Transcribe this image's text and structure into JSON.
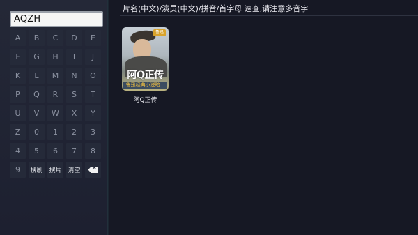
{
  "search": {
    "query": "AQZH"
  },
  "keyboard": {
    "keys": [
      "A",
      "B",
      "C",
      "D",
      "E",
      "F",
      "G",
      "H",
      "I",
      "J",
      "K",
      "L",
      "M",
      "N",
      "O",
      "P",
      "Q",
      "R",
      "S",
      "T",
      "U",
      "V",
      "W",
      "X",
      "Y",
      "Z",
      "0",
      "1",
      "2",
      "3",
      "4",
      "5",
      "6",
      "7",
      "8",
      "9"
    ],
    "actions": {
      "search_drama": "搜剧",
      "search_movie": "搜片",
      "clear": "清空"
    },
    "backspace_icon": "backspace-icon"
  },
  "hint": "片名(中文)/演员(中文)/拼音/首字母 速查,请注意多音字",
  "results": [
    {
      "title": "阿Q正传",
      "poster": {
        "badge": "鲁迅",
        "art_title": "阿Q正传",
        "caption": "鲁迅经典小说暗..."
      }
    }
  ],
  "colors": {
    "background": "#161824",
    "panel": "#242837",
    "key": "#252a39",
    "caption_text": "#f0c040"
  }
}
